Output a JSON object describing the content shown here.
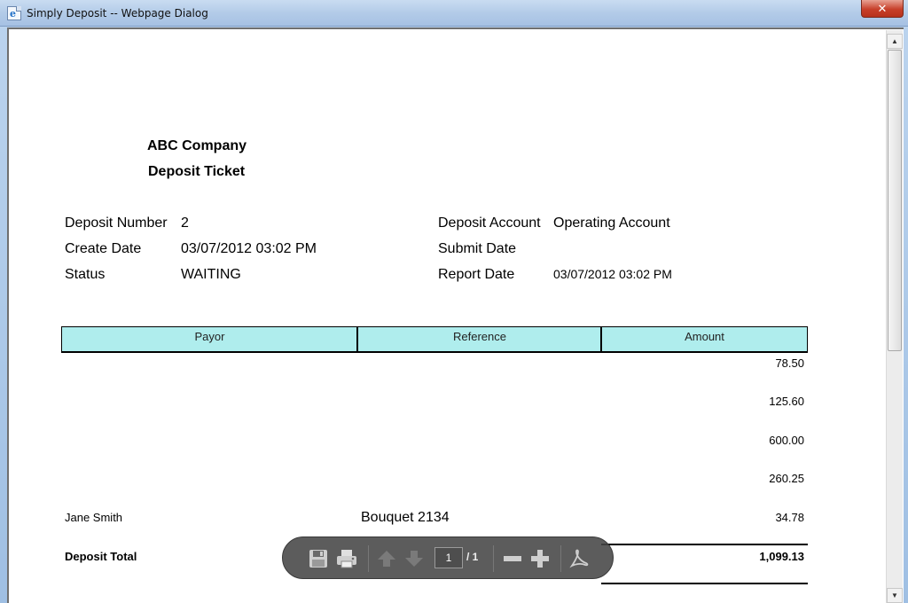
{
  "window": {
    "title": "Simply Deposit -- Webpage Dialog",
    "close_label": "✕"
  },
  "report": {
    "company": "ABC Company",
    "doc_title": "Deposit Ticket",
    "fields": {
      "deposit_number_label": "Deposit Number",
      "deposit_number": "2",
      "create_date_label": "Create Date",
      "create_date": "03/07/2012 03:02 PM",
      "status_label": "Status",
      "status": "WAITING",
      "deposit_account_label": "Deposit Account",
      "deposit_account": "Operating Account",
      "submit_date_label": "Submit Date",
      "submit_date": "",
      "report_date_label": "Report Date",
      "report_date": "03/07/2012 03:02 PM"
    },
    "table": {
      "headers": [
        "Payor",
        "Reference",
        "Amount"
      ],
      "rows": [
        {
          "payor": "",
          "reference": "",
          "amount": "78.50"
        },
        {
          "payor": "",
          "reference": "",
          "amount": "125.60"
        },
        {
          "payor": "",
          "reference": "",
          "amount": "600.00"
        },
        {
          "payor": "",
          "reference": "",
          "amount": "260.25"
        },
        {
          "payor": "Jane Smith",
          "reference": "Bouquet 2134",
          "amount": "34.78"
        }
      ],
      "total_label": "Deposit Total",
      "total": "1,099.13"
    }
  },
  "pdf_toolbar": {
    "current_page": "1",
    "page_count": "/ 1",
    "icons": [
      "save-icon",
      "print-icon",
      "page-up-icon",
      "page-down-icon",
      "zoom-out-icon",
      "zoom-in-icon",
      "acrobat-icon"
    ]
  }
}
